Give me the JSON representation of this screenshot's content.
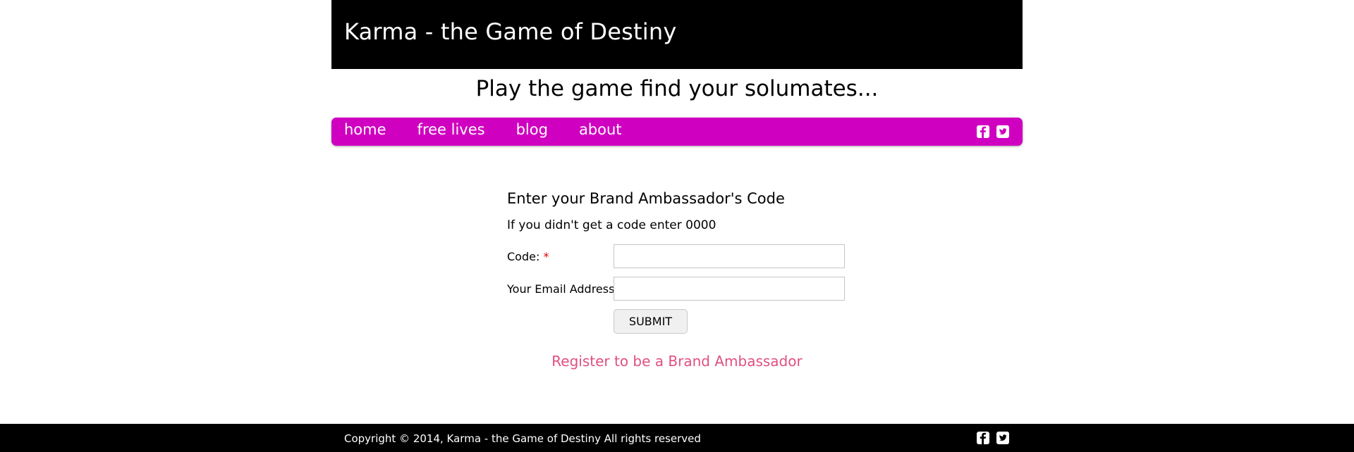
{
  "header": {
    "title": "Karma - the Game of Destiny"
  },
  "tagline": "Play the game find your solumates...",
  "nav": {
    "items": [
      {
        "label": "home"
      },
      {
        "label": "free lives"
      },
      {
        "label": "blog"
      },
      {
        "label": "about"
      }
    ],
    "social": [
      "facebook-icon",
      "twitter-icon"
    ]
  },
  "form": {
    "heading": "Enter your Brand Ambassador's Code",
    "hint": "If you didn't get a code enter 0000",
    "code_label": "Code:",
    "email_label": "Your Email Address:",
    "required_mark": "*",
    "code_value": "",
    "email_value": "",
    "submit_label": "SUBMIT"
  },
  "register_link": "Register to be a Brand Ambassador",
  "footer": {
    "copyright": "Copyright © 2014, Karma - the Game of Destiny  All rights reserved",
    "social": [
      "facebook-icon",
      "twitter-icon"
    ]
  },
  "colors": {
    "header_bg": "#000000",
    "nav_bg": "#d000c0",
    "link": "#e0507e",
    "required": "#e00000"
  }
}
